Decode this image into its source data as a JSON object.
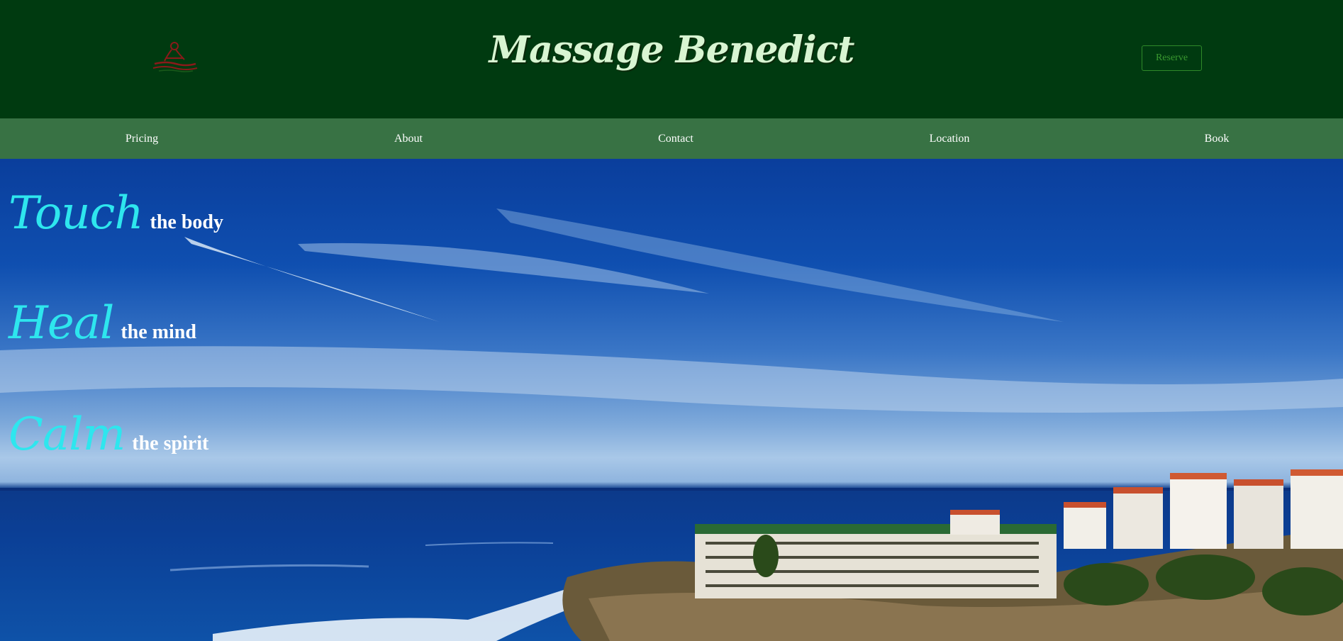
{
  "header": {
    "logo_icon": "massage-person-icon",
    "title": "Massage Benedict",
    "reserve_label": "Reserve"
  },
  "nav": {
    "items": [
      {
        "label": "Pricing"
      },
      {
        "label": "About"
      },
      {
        "label": "Contact"
      },
      {
        "label": "Location"
      },
      {
        "label": "Book"
      }
    ]
  },
  "hero": {
    "background": "coastal town seaside photo",
    "taglines": [
      {
        "script": "Touch",
        "rest": "the body"
      },
      {
        "script": "Heal",
        "rest": "the mind"
      },
      {
        "script": "Calm",
        "rest": "the spirit"
      }
    ]
  },
  "colors": {
    "header_bg": "#003a10",
    "nav_bg": "#387244",
    "title": "#d8f5d2",
    "accent_script": "#2ee6ee",
    "reserve_border": "#2f8a2a"
  }
}
